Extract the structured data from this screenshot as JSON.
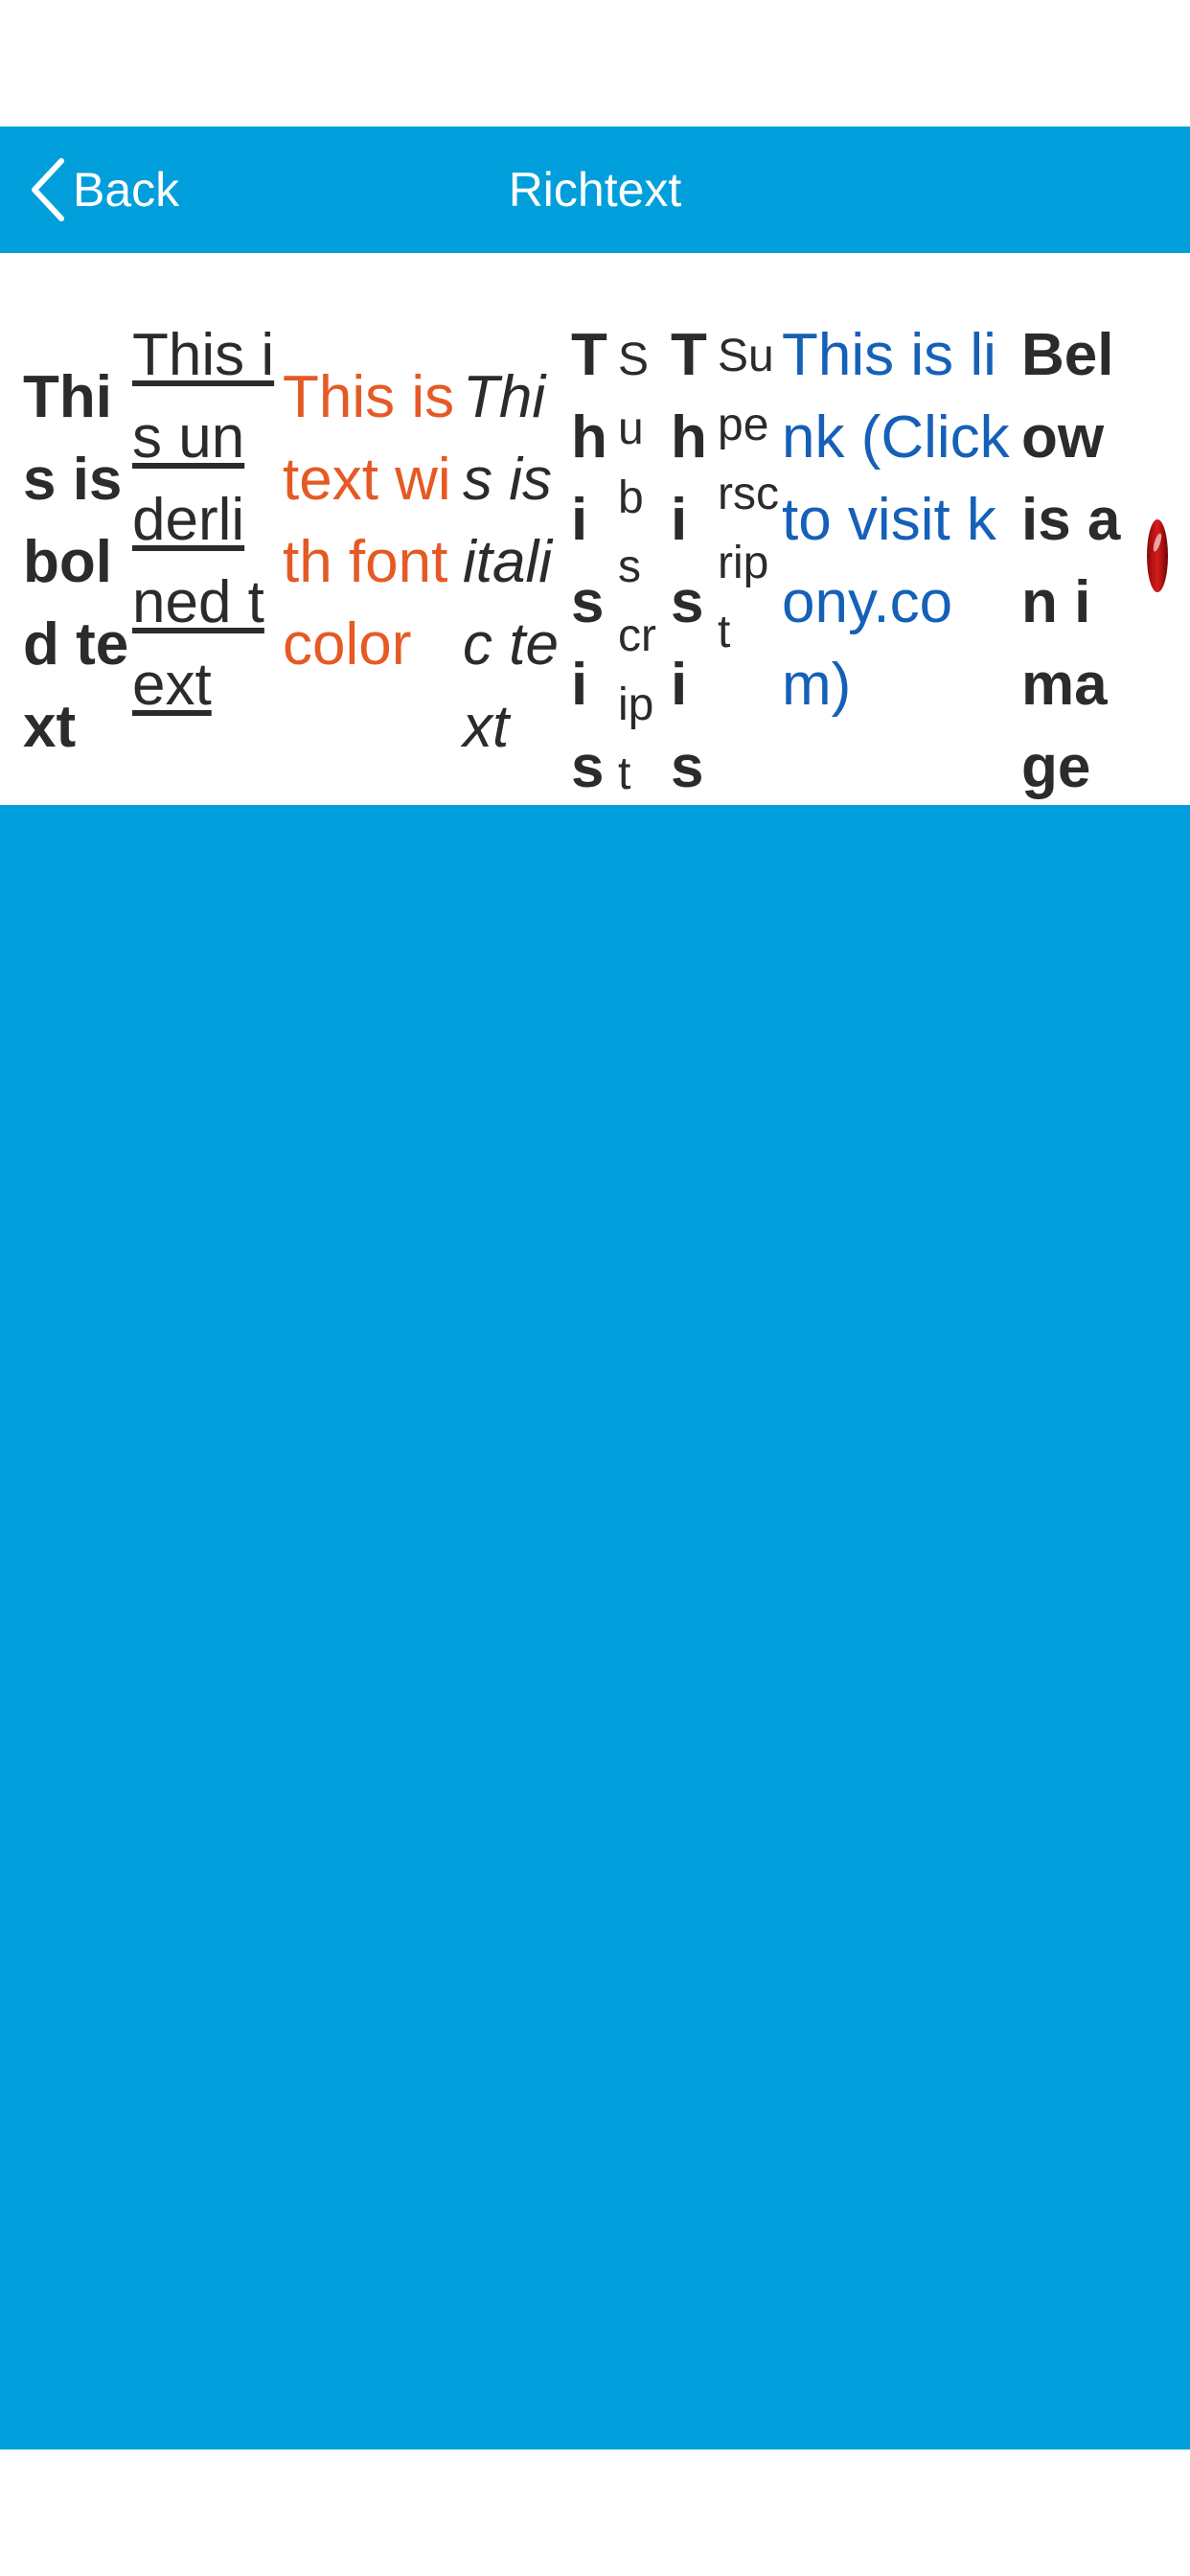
{
  "header": {
    "back_label": "Back",
    "title": "Richtext"
  },
  "richtext": {
    "bold": "This is bold text",
    "underlined": "This is underlined text",
    "colored": "This is text with font color",
    "italic": "This is italic text",
    "this_1": "This is",
    "subscript": "Subscript",
    "this_2": "This is",
    "superscript": "Superscript",
    "link": "This is link (Click to visit kony.com)",
    "image_label": "Below is an image"
  },
  "icons": {
    "back": "chevron-left-icon",
    "image": "red-image-mark"
  },
  "colors": {
    "brand_blue": "#009fdb",
    "text_dark": "#2b2b2b",
    "text_orange": "#e55a24",
    "link_blue": "#1560b8",
    "header_text": "#ffffff"
  }
}
